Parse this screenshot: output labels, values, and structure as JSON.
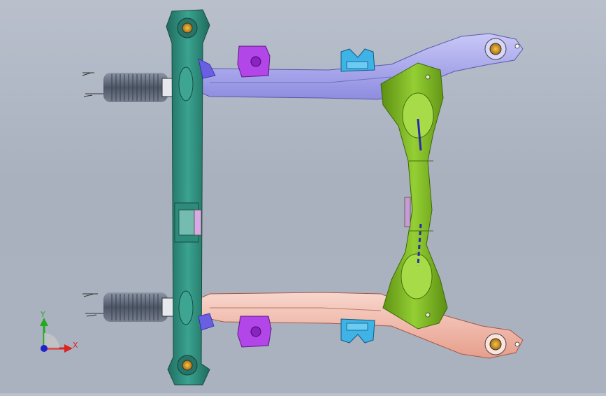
{
  "viewport": {
    "background_top": "#b9c0cc",
    "background_bottom": "#aab2c0"
  },
  "model": {
    "colors": {
      "front_rail": "#2f8f7f",
      "front_rail_dark": "#1f6a5d",
      "upper_arm": "#aaa9ee",
      "lower_arm": "#f0b7a8",
      "rear_cross": "#79b520",
      "rear_cross_dark": "#5c8f12",
      "bracket_purple": "#b246e8",
      "bracket_cyan": "#3fb2e6",
      "bushing_gold": "#d89a20",
      "bushing_gray": "#5a6270",
      "accent_blue": "#2a2aa8"
    }
  },
  "triad": {
    "y_label": "Y",
    "x_label": "X",
    "y_color": "#22aa22",
    "x_color": "#dd2222",
    "z_color": "#2222cc"
  }
}
